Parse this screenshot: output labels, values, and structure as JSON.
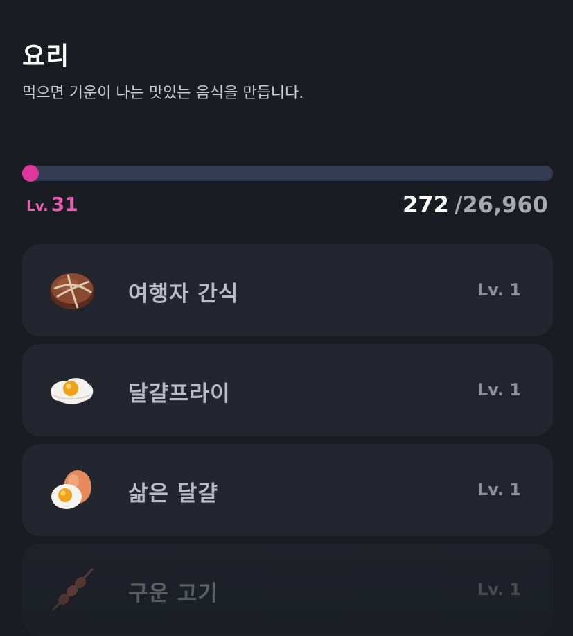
{
  "header": {
    "title": "요리",
    "subtitle": "먹으면 기운이 나는 맛있는 음식을 만듭니다."
  },
  "progress": {
    "fraction": 0.0101,
    "level_prefix": "Lv.",
    "level_value": "31",
    "exp_current": "272",
    "exp_total": "/26,960"
  },
  "colors": {
    "accent": "#e0379c",
    "track": "#343a52",
    "card": "#23262f",
    "background": "#191c22"
  },
  "recipes": [
    {
      "name": "여행자 간식",
      "level": "Lv. 1",
      "icon": "wrapped-snack-icon"
    },
    {
      "name": "달걀프라이",
      "level": "Lv. 1",
      "icon": "fried-egg-icon"
    },
    {
      "name": "삶은 달걀",
      "level": "Lv. 1",
      "icon": "boiled-egg-icon"
    },
    {
      "name": "구운 고기",
      "level": "Lv. 1",
      "icon": "meat-skewer-icon"
    }
  ]
}
